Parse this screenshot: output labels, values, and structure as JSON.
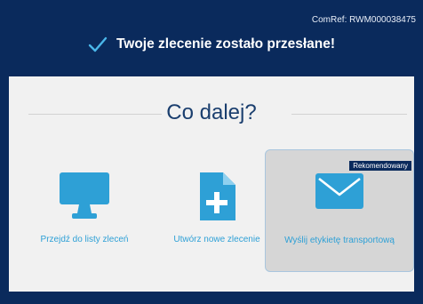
{
  "header": {
    "comref": "ComRef: RWM000038475",
    "title": "Twoje zlecenie zostało przesłane!"
  },
  "main": {
    "heading": "Co dalej?",
    "options": [
      {
        "label": "Przejdź do listy zleceń",
        "icon": "monitor-icon"
      },
      {
        "label": "Utwórz nowe zlecenie",
        "icon": "new-document-icon"
      },
      {
        "label": "Wyślij etykietę transportową",
        "icon": "envelope-icon",
        "badge": "Rekomendowany"
      }
    ]
  },
  "colors": {
    "navy": "#0a2a5c",
    "accent": "#2ea0d6",
    "panel": "#f1f1f1"
  }
}
